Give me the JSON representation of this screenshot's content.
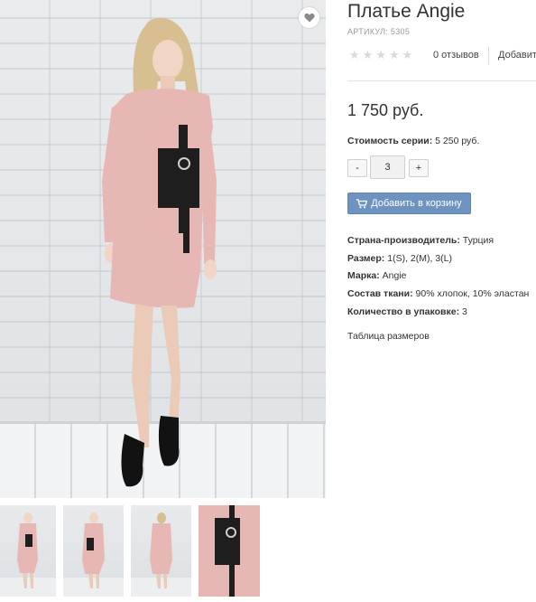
{
  "product": {
    "title": "Платье Angie",
    "sku": "АРТИКУЛ: 5305",
    "rating": {
      "value": 0,
      "max": 5
    },
    "reviews_label": "0 отзывов",
    "add_review_label": "Добавить",
    "price": "1 750 руб.",
    "series_label": "Стоимость серии:",
    "series_value": "5 250 руб."
  },
  "quantity": {
    "minus": "-",
    "value": "3",
    "plus": "+"
  },
  "cart": {
    "label": "Добавить в корзину",
    "icon": "cart-icon"
  },
  "specs": [
    {
      "label": "Страна-производитель:",
      "value": "Турция"
    },
    {
      "label": "Размер:",
      "value": "1(S), 2(M), 3(L)"
    },
    {
      "label": "Марка:",
      "value": "Angie"
    },
    {
      "label": "Состав ткани:",
      "value": "90% хлопок, 10% эластан"
    },
    {
      "label": "Количество в упаковке:",
      "value": "3"
    }
  ],
  "size_table_link": "Таблица размеров",
  "favorite": {
    "icon": "heart-icon"
  },
  "colors": {
    "accent": "#6e93c0",
    "dress": "#e7b8b3",
    "panel": "#1e1e1e"
  }
}
